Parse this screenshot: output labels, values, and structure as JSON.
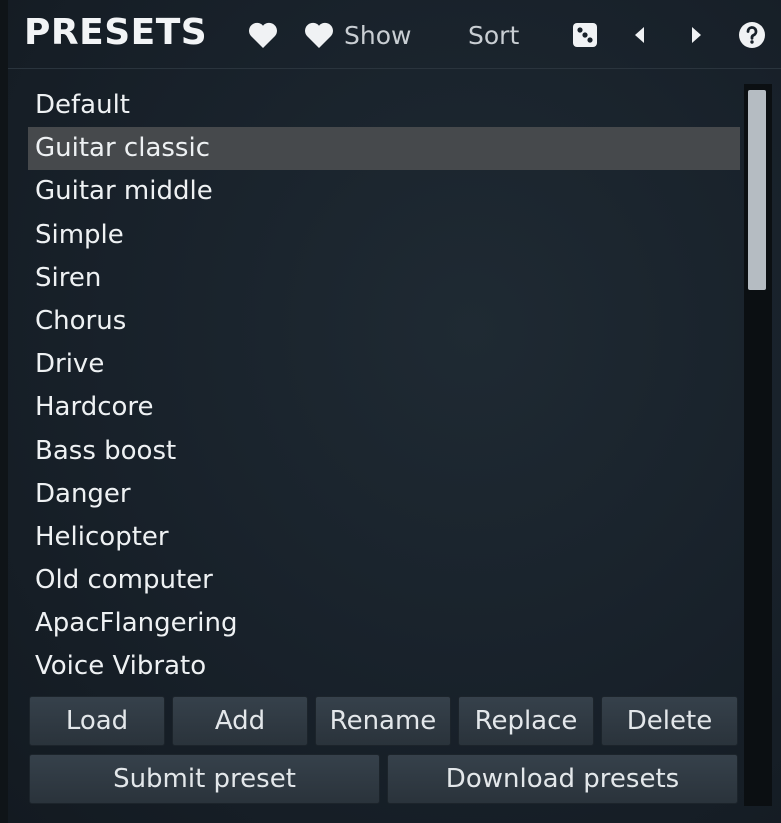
{
  "header": {
    "title": "PRESETS",
    "favorite_icon": "heart-icon",
    "show_icon": "heart-icon",
    "show_label": "Show",
    "sort_label": "Sort",
    "random_icon": "dice-icon",
    "prev_icon": "triangle-left-icon",
    "next_icon": "triangle-right-icon",
    "help_icon": "question-circle-icon"
  },
  "presets": {
    "selected_index": 1,
    "items": [
      "Default",
      "Guitar classic",
      "Guitar middle",
      "Simple",
      "Siren",
      "Chorus",
      "Drive",
      "Hardcore",
      "Bass boost",
      "Danger",
      "Helicopter",
      "Old computer",
      "ApacFlangering",
      "Voice Vibrato"
    ]
  },
  "buttons": {
    "load": "Load",
    "add": "Add",
    "rename": "Rename",
    "replace": "Replace",
    "delete": "Delete",
    "submit": "Submit preset",
    "download": "Download presets"
  },
  "colors": {
    "background": "#18212a",
    "selection": "#46494c",
    "scrollbar_thumb": "#b5bcc2"
  }
}
